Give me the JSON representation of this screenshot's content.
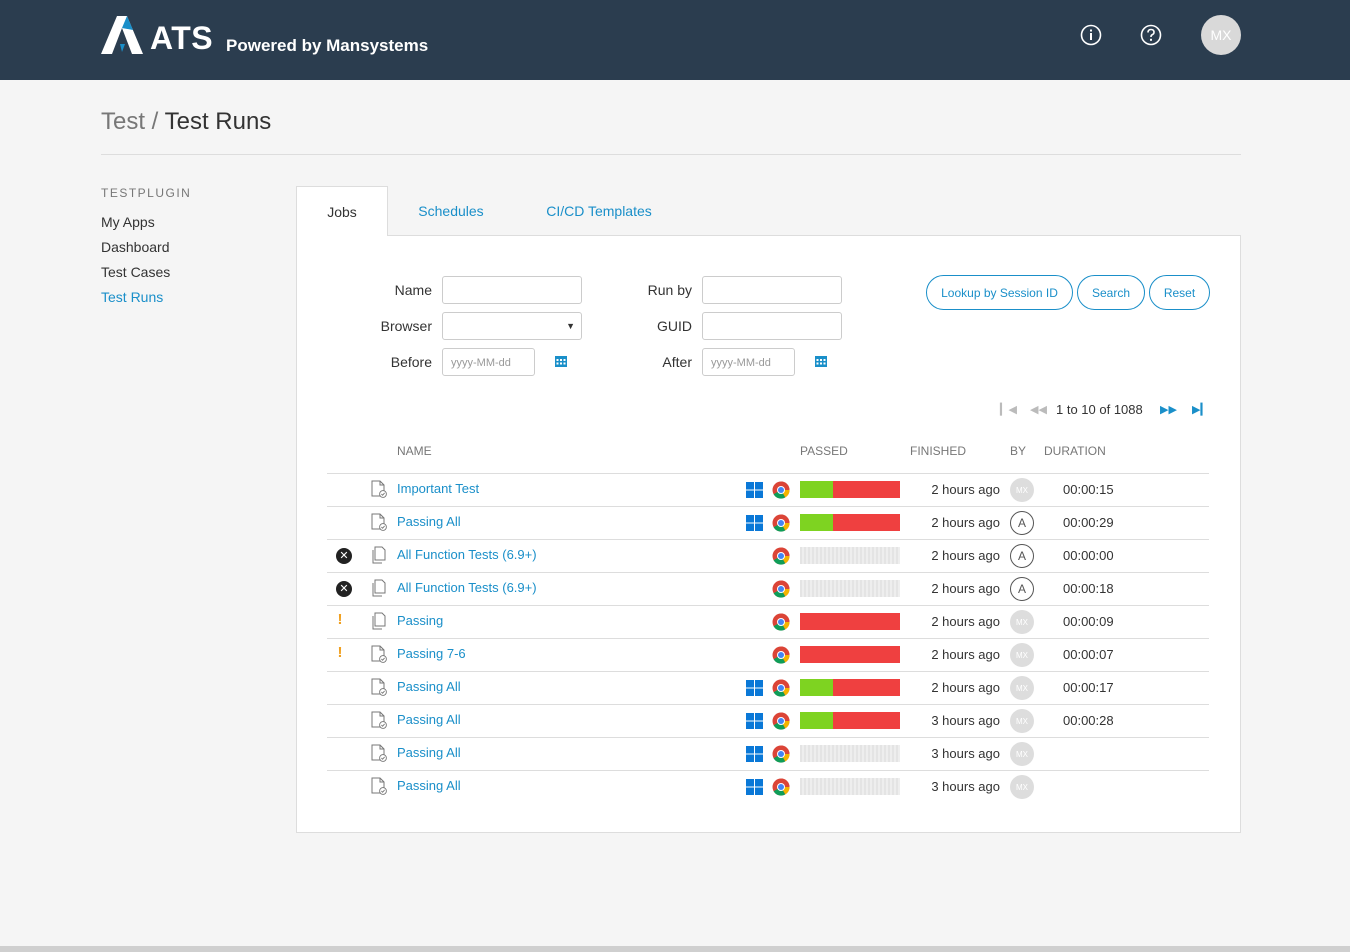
{
  "header": {
    "logo_text": "ATS",
    "logo_subtitle": "Powered by Mansystems",
    "user_initials": "MX"
  },
  "breadcrumb": {
    "parent": "Test",
    "separator": " / ",
    "current": "Test Runs"
  },
  "sidebar": {
    "heading": "TESTPLUGIN",
    "items": [
      {
        "label": "My Apps"
      },
      {
        "label": "Dashboard"
      },
      {
        "label": "Test Cases"
      },
      {
        "label": "Test Runs"
      }
    ]
  },
  "tabs": [
    {
      "label": "Jobs"
    },
    {
      "label": "Schedules"
    },
    {
      "label": "CI/CD Templates"
    }
  ],
  "filters": {
    "name_label": "Name",
    "browser_label": "Browser",
    "before_label": "Before",
    "runby_label": "Run by",
    "guid_label": "GUID",
    "after_label": "After",
    "date_placeholder": "yyyy-MM-dd"
  },
  "buttons": {
    "lookup": "Lookup by Session ID",
    "search": "Search",
    "reset": "Reset"
  },
  "pager": {
    "text": "1 to 10 of 1088"
  },
  "columns": {
    "name": "NAME",
    "passed": "PASSED",
    "finished": "FINISHED",
    "by": "BY",
    "duration": "DURATION"
  },
  "rows": [
    {
      "status": "none",
      "name": "Important Test",
      "windows": true,
      "passed_fraction": 0.33,
      "finished": "2 hours ago",
      "by": "MX",
      "duration": "00:00:15"
    },
    {
      "status": "none",
      "name": "Passing All",
      "windows": true,
      "passed_fraction": 0.33,
      "finished": "2 hours ago",
      "by": "A",
      "duration": "00:00:29"
    },
    {
      "status": "fail",
      "name": "All Function Tests (6.9+)",
      "windows": false,
      "passed_fraction": null,
      "finished": "2 hours ago",
      "by": "A",
      "duration": "00:00:00"
    },
    {
      "status": "fail",
      "name": "All Function Tests (6.9+)",
      "windows": false,
      "passed_fraction": null,
      "finished": "2 hours ago",
      "by": "A",
      "duration": "00:00:18"
    },
    {
      "status": "warn",
      "name": "Passing",
      "windows": false,
      "passed_fraction": 0,
      "finished": "2 hours ago",
      "by": "MX",
      "duration": "00:00:09"
    },
    {
      "status": "warn",
      "name": "Passing 7-6",
      "windows": false,
      "passed_fraction": 0,
      "finished": "2 hours ago",
      "by": "MX",
      "duration": "00:00:07"
    },
    {
      "status": "none",
      "name": "Passing All",
      "windows": true,
      "passed_fraction": 0.33,
      "finished": "2 hours ago",
      "by": "MX",
      "duration": "00:00:17"
    },
    {
      "status": "none",
      "name": "Passing All",
      "windows": true,
      "passed_fraction": 0.33,
      "finished": "3 hours ago",
      "by": "MX",
      "duration": "00:00:28"
    },
    {
      "status": "none",
      "name": "Passing All",
      "windows": true,
      "passed_fraction": null,
      "finished": "3 hours ago",
      "by": "MX",
      "duration": ""
    },
    {
      "status": "none",
      "name": "Passing All",
      "windows": true,
      "passed_fraction": null,
      "finished": "3 hours ago",
      "by": "MX",
      "duration": ""
    }
  ],
  "colors": {
    "header_bg": "#2b3d4f",
    "accent": "#1a8fc9",
    "pass": "#7ed321",
    "fail": "#ef4040"
  }
}
